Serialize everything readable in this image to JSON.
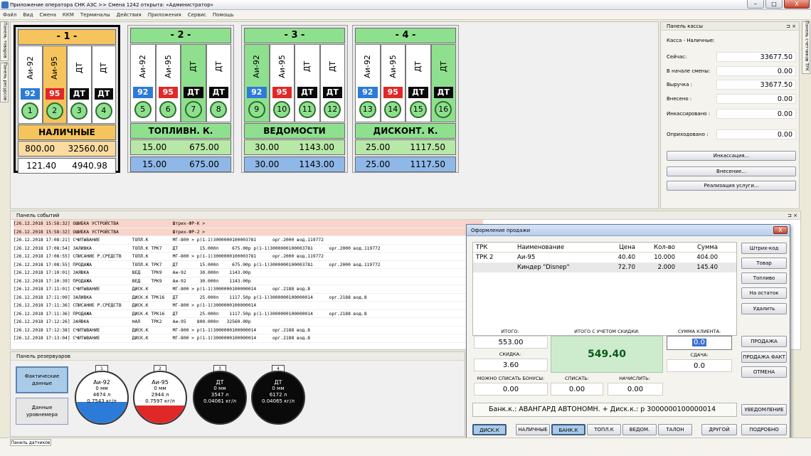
{
  "window": {
    "title": "Приложение оператора СНК АЗС >> Смена 1242 открыта: «Администратор»",
    "minimize": "–",
    "maximize": "□",
    "close": "X"
  },
  "menu": [
    "Файл",
    "Вид",
    "Смена",
    "ККМ",
    "Терминалы",
    "Действия",
    "Приложения",
    "Сервис",
    "Помощь"
  ],
  "left_tabs": [
    "Панель товаров",
    "Панель ресурсов"
  ],
  "right_tabs": [
    "Панель счетчиков ТРК"
  ],
  "pumps": [
    {
      "id": "- 1 -",
      "payment": "НАЛИЧНЫЕ",
      "val1": "800.00",
      "val2": "32560.00",
      "val3": "121.40",
      "val4": "4940.98",
      "nozzles": [
        {
          "name": "Аи-92",
          "grade": "92",
          "num": "1"
        },
        {
          "name": "Аи-95",
          "grade": "95",
          "num": "2"
        },
        {
          "name": "ДТ",
          "grade": "ДТ",
          "num": "3"
        },
        {
          "name": "ДТ",
          "grade": "ДТ",
          "num": "4"
        }
      ]
    },
    {
      "id": "- 2 -",
      "payment": "ТОПЛИВН. К.",
      "val1": "15.00",
      "val2": "675.00",
      "val3": "15.00",
      "val4": "675.00",
      "nozzles": [
        {
          "name": "Аи-92",
          "grade": "92",
          "num": "5"
        },
        {
          "name": "Аи-95",
          "grade": "95",
          "num": "6"
        },
        {
          "name": "ДТ",
          "grade": "ДТ",
          "num": "7"
        },
        {
          "name": "ДТ",
          "grade": "ДТ",
          "num": "8"
        }
      ]
    },
    {
      "id": "- 3 -",
      "payment": "ВЕДОМОСТИ",
      "val1": "30.00",
      "val2": "1143.00",
      "val3": "30.00",
      "val4": "1143.00",
      "nozzles": [
        {
          "name": "Аи-92",
          "grade": "92",
          "num": "9"
        },
        {
          "name": "Аи-95",
          "grade": "95",
          "num": "10"
        },
        {
          "name": "ДТ",
          "grade": "ДТ",
          "num": "11"
        },
        {
          "name": "ДТ",
          "grade": "ДТ",
          "num": "12"
        }
      ]
    },
    {
      "id": "- 4 -",
      "payment": "ДИСКОНТ. К.",
      "val1": "25.00",
      "val2": "1117.50",
      "val3": "25.00",
      "val4": "1117.50",
      "nozzles": [
        {
          "name": "Аи-92",
          "grade": "92",
          "num": "13"
        },
        {
          "name": "Аи-95",
          "grade": "95",
          "num": "14"
        },
        {
          "name": "ДТ",
          "grade": "ДТ",
          "num": "15"
        },
        {
          "name": "ДТ",
          "grade": "ДТ",
          "num": "16"
        }
      ]
    }
  ],
  "kassa": {
    "title": "Панель кассы",
    "subtitle": "Касса - Наличные:",
    "rows": [
      {
        "label": "Сейчас:",
        "value": "33677.50"
      },
      {
        "label": "В начале смены:",
        "value": "0.00"
      },
      {
        "label": "Выручка :",
        "value": "33677.50"
      },
      {
        "label": "Внесено :",
        "value": "0.00"
      },
      {
        "label": "Инкассировано :",
        "value": "0.00"
      },
      {
        "label": "Оприходовано :",
        "value": "0.00"
      }
    ],
    "buttons": [
      "Инкассация...",
      "Внесение...",
      "Реализация услуги..."
    ]
  },
  "events": {
    "title": "Панель событий",
    "rows": [
      {
        "t": "[26.12.2018 15:58:32] ОШИБКА УСТРОЙСТВА                    Штрих-ФР-К >",
        "err": true
      },
      {
        "t": "[26.12.2018 15:58:32] ОШИБКА УСТРОЙСТВА                    Штрих-ФР-2 >",
        "err": true
      },
      {
        "t": "[26.12.2018 17:08:21] СЧИТЫВАНИЕ            ТОПЛ.К         МГ-800 > р(1-1)3000000100003781      орг.2000 вод.119772",
        "err": false
      },
      {
        "t": "[26.12.2018 17:08:54] ЗАЛИВКА               ТОПЛ.К ТРК7    ДТ        15.000л     675.00р р(1-1)3000000100003781      орг.2000 вод.119772",
        "err": false
      },
      {
        "t": "[26.12.2018 17:08:55] СПИСАНИЕ Р.СРЕДСТВ    ТОПЛ.К         МГ-800 > р(1-1)3000000100003781      орг.2000 вод.119772",
        "err": false
      },
      {
        "t": "[26.12.2018 17:08:55] ПРОДАЖА               ТОПЛ.К ТРК7    ДТ        15.000л     675.00р р(1-1)3000000100003781      орг.2000 вод.119772",
        "err": false
      },
      {
        "t": "[26.12.2018 17:10:01] ЗАЯВКА                ВЕД    ТРК9    Аи-92     30.000л    1143.00р",
        "err": false
      },
      {
        "t": "[26.12.2018 17:10:39] ПРОДАЖА               ВЕД    ТРК9    Аи-92     30.000л    1143.00р",
        "err": false
      },
      {
        "t": "[26.12.2018 17:11:01] СЧИТЫВАНИЕ            ДИСК.К         МГ-800 > р(1-1)3000000100000014      орг.2188 вод.8",
        "err": false
      },
      {
        "t": "[26.12.2018 17:11:09] ЗАЛИВКА               ДИСК.К ТРК16   ДТ        25.000л    1117.50р р(1-1)3000000100000014      орг.2188 вод.8",
        "err": false
      },
      {
        "t": "[26.12.2018 17:11:36] СПИСАНИЕ Р.СРЕДСТВ    ДИСК.К         МГ-800 > р(1-1)3000000100000014",
        "err": false
      },
      {
        "t": "[26.12.2018 17:11:36] ПРОДАЖА               ДИСК.К ТРК16   ДТ        25.000л    1117.50р р(1-1)3000000100000014      орг.2188 вод.8",
        "err": false
      },
      {
        "t": "[26.12.2018 17:12:26] ЗАЯВКА                НАЛ    ТРК2    Аи-95    800.000л   32560.00р",
        "err": false
      },
      {
        "t": "[26.12.2018 17:12:38] СЧИТЫВАНИЕ            ДИСК.К         МГ-800 > р(1-1)3000000100000014      орг.2188 вод.8",
        "err": false
      },
      {
        "t": "[26.12.2018 17:13:04] СЧИТЫВАНИЕ            ДИСК.К         МГ-800 > р(1-1)3000000100000014      орг.2188 вод.8",
        "err": false
      }
    ]
  },
  "tanks_panel": {
    "title": "Панель резервуаров",
    "btn_actual": "Фактические данные",
    "btn_gauge": "Данные уровнемера",
    "tanks": [
      {
        "num": "1",
        "name": "Аи-92",
        "level": "0 мм",
        "volume": "4674 л",
        "density": "0.7543 кг/л",
        "fill": 0.42,
        "color": "#2d7bd8"
      },
      {
        "num": "2",
        "name": "Аи-95",
        "level": "0 мм",
        "volume": "2944 л",
        "density": "0.7597 кг/л",
        "fill": 0.35,
        "color": "#e12828"
      },
      {
        "num": "3",
        "name": "ДТ",
        "level": "0 мм",
        "volume": "3547 л",
        "density": "0.04061 кг/л",
        "fill": 0.48,
        "color": "#0a0a0a"
      },
      {
        "num": "4",
        "name": "ДТ",
        "level": "0 мм",
        "volume": "6172 л",
        "density": "0.04065 кг/л",
        "fill": 0.62,
        "color": "#0a0a0a"
      }
    ]
  },
  "sale": {
    "title": "Оформление продажи",
    "close": "X",
    "headers": {
      "trk": "ТРК",
      "name": "Наименование",
      "price": "Цена",
      "qty": "Кол-во",
      "sum": "Сумма"
    },
    "rows": [
      {
        "trk": "ТРК 2",
        "name": "Аи-95",
        "price": "40.40",
        "qty": "10.000",
        "sum": "404.00"
      },
      {
        "trk": "",
        "name": "Киндер \"Disnep\"",
        "price": "72.70",
        "qty": "2.000",
        "sum": "145.40"
      }
    ],
    "side_buttons": [
      "Штрих-код",
      "Товар",
      "Топливо",
      "На остаток",
      "Удалить"
    ],
    "action_buttons": [
      "ПРОДАЖА",
      "ПРОДАЖА ФАКТ",
      "ОТМЕНА"
    ],
    "notify": "УВЕДОМЛЕНИЕ",
    "itogo_label": "ИТОГО:",
    "itogo": "553.00",
    "discount_label": "СКИДКА:",
    "discount": "3.60",
    "with_discount_label": "ИТОГО С УЧЕТОМ СКИДКИ:",
    "with_discount": "549.40",
    "client_label": "СУММА КЛИЕНТА:",
    "client": "0.0",
    "change_label": "СДАЧА:",
    "change": "0.0",
    "bonus_label": "МОЖНО СПИСАТЬ БОНУСЫ:",
    "bonus": "0.00",
    "writeoff_label": "СПИСАТЬ:",
    "writeoff": "0.00",
    "accrue_label": "НАЧИСЛИТЬ:",
    "accrue": "0.00",
    "bank_info": "Банк.к.: АВАНГАРД АВТОНОМН.  +  Диск.к.: р 3000000100000014",
    "pay_buttons": [
      "ДИСК.К",
      "НАЛИЧНЫЕ",
      "БАНК.К",
      "ТОПЛ.К",
      "ВЕДОМ.",
      "ТАЛОН",
      "ДРУГОЙ",
      "ПОДРОБНО"
    ]
  },
  "status": {
    "tab": "Панель датчиков"
  }
}
